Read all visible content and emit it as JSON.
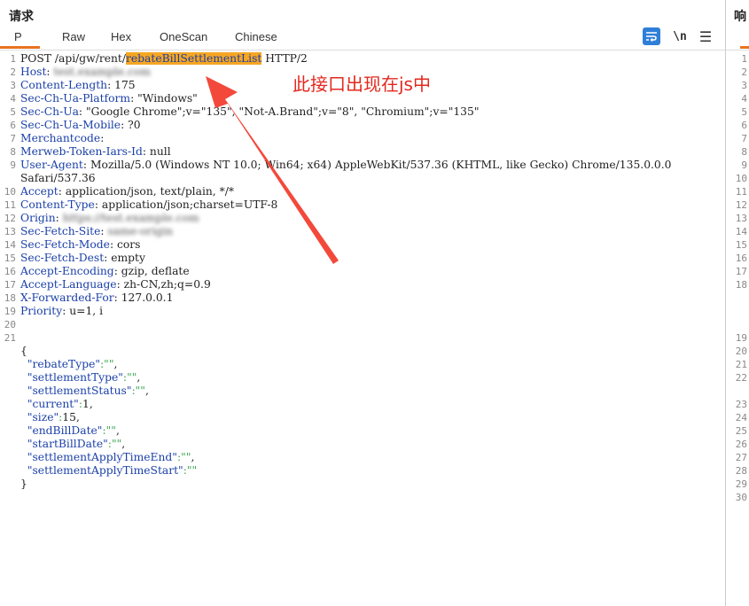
{
  "panel": {
    "title": "请求",
    "tabs": [
      "Pretty",
      "Raw",
      "Hex",
      "OneScan",
      "Chinese"
    ],
    "active_tab": "Pretty",
    "tools": {
      "newline": "\\n",
      "menu": "☰"
    }
  },
  "request_line": {
    "method": "POST",
    "path_prefix": "/api/gw/rent/",
    "endpoint": "rebateBillSettlementList",
    "protocol": "HTTP/2"
  },
  "headers": [
    {
      "n": 2,
      "name": "Host",
      "value": "test.example.com",
      "blurred": true
    },
    {
      "n": 3,
      "name": "Content-Length",
      "value": "175"
    },
    {
      "n": 4,
      "name": "Sec-Ch-Ua-Platform",
      "value": "\"Windows\""
    },
    {
      "n": 5,
      "name": "Sec-Ch-Ua",
      "value": "\"Google Chrome\";v=\"135\", \"Not-A.Brand\";v=\"8\", \"Chromium\";v=\"135\""
    },
    {
      "n": 6,
      "name": "Sec-Ch-Ua-Mobile",
      "value": "?0"
    },
    {
      "n": 7,
      "name": "Merchantcode",
      "value": ""
    },
    {
      "n": 8,
      "name": "Merweb-Token-Iars-Id",
      "value": "null"
    },
    {
      "n": 9,
      "name": "User-Agent",
      "value": "Mozilla/5.0 (Windows NT 10.0; Win64; x64) AppleWebKit/537.36 (KHTML, like Gecko) Chrome/135.0.0.0"
    },
    {
      "n": 0,
      "name": "",
      "value": "Safari/537.36"
    },
    {
      "n": 10,
      "name": "Accept",
      "value": "application/json, text/plain, */*"
    },
    {
      "n": 11,
      "name": "Content-Type",
      "value": "application/json;charset=UTF-8"
    },
    {
      "n": 12,
      "name": "Origin",
      "value": "https://test.example.com",
      "blurred": true
    },
    {
      "n": 13,
      "name": "Sec-Fetch-Site",
      "value": "same-origin",
      "blurred": true
    },
    {
      "n": 14,
      "name": "Sec-Fetch-Mode",
      "value": "cors"
    },
    {
      "n": 15,
      "name": "Sec-Fetch-Dest",
      "value": "empty"
    },
    {
      "n": 16,
      "name": "Accept-Encoding",
      "value": "gzip, deflate"
    },
    {
      "n": 17,
      "name": "Accept-Language",
      "value": "zh-CN,zh;q=0.9"
    },
    {
      "n": 18,
      "name": "X-Forwarded-For",
      "value": "127.0.0.1"
    },
    {
      "n": 19,
      "name": "Priority",
      "value": "u=1, i"
    }
  ],
  "body": {
    "open_brace": "{",
    "close_brace": "}",
    "fields": [
      {
        "key": "rebateType",
        "value": "\"\"",
        "type": "str"
      },
      {
        "key": "settlementType",
        "value": "\"\"",
        "type": "str"
      },
      {
        "key": "settlementStatus",
        "value": "\"\"",
        "type": "str"
      },
      {
        "key": "current",
        "value": "1",
        "type": "num"
      },
      {
        "key": "size",
        "value": "15",
        "type": "num"
      },
      {
        "key": "endBillDate",
        "value": "\"\"",
        "type": "str"
      },
      {
        "key": "startBillDate",
        "value": "\"\"",
        "type": "str"
      },
      {
        "key": "settlementApplyTimeEnd",
        "value": "\"\"",
        "type": "str"
      },
      {
        "key": "settlementApplyTimeStart",
        "value": "\"\"",
        "type": "str"
      }
    ]
  },
  "annotation": {
    "text": "此接口出现在js中",
    "color": "#e3281e"
  },
  "response_panel": {
    "title": "响",
    "line_numbers": [
      "1",
      "2",
      "3",
      "4",
      "5",
      "6",
      "7",
      "8",
      "9",
      "10",
      "11",
      "12",
      "13",
      "14",
      "15",
      "16",
      "17",
      "18",
      "19",
      "20",
      "21",
      "22",
      "23",
      "24",
      "25",
      "26",
      "27",
      "28",
      "29",
      "30"
    ]
  },
  "colors": {
    "accent": "#e8731f",
    "highlight": "#f5a623",
    "key": "#1a3fa8",
    "json_punct": "#3aa653",
    "wrap_button": "#2f7fd8"
  }
}
